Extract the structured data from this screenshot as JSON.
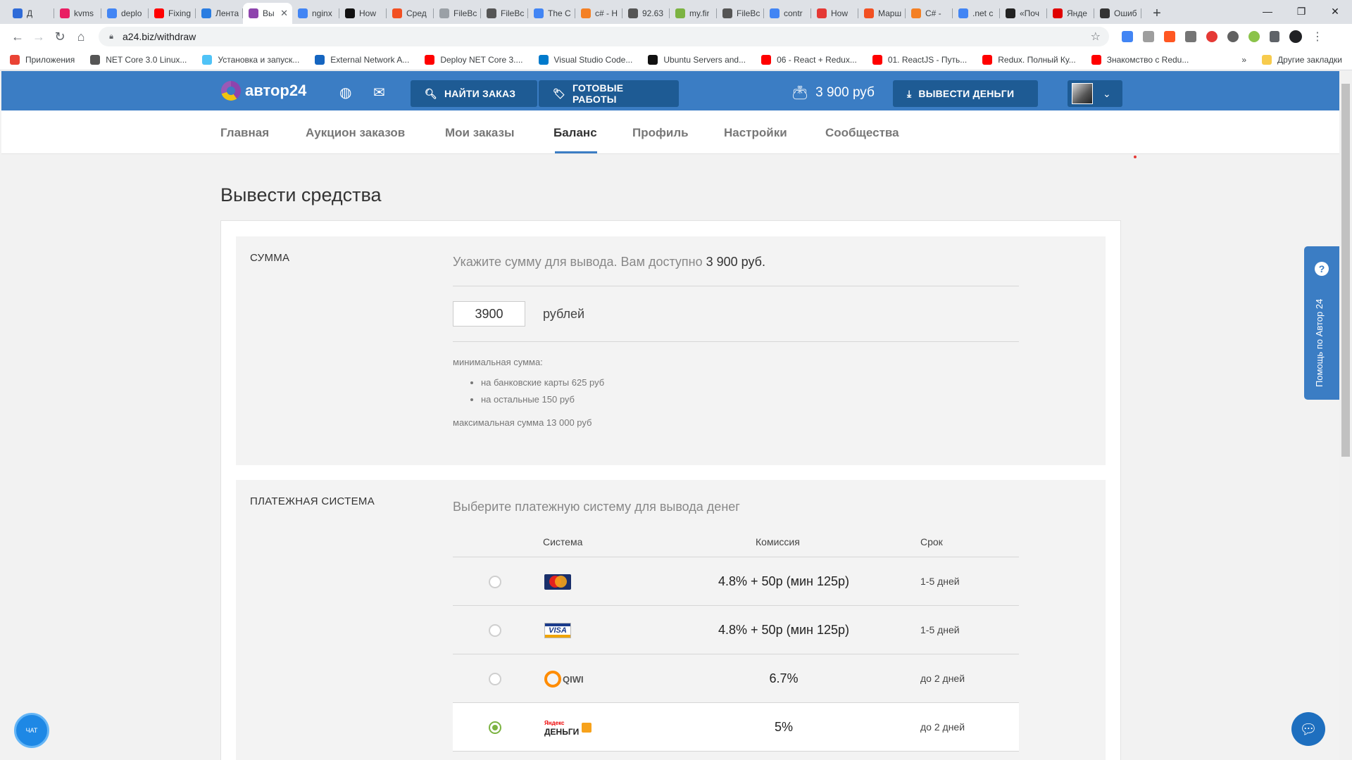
{
  "browser": {
    "tabs": [
      {
        "title": "Д",
        "color": "#2f6bd8"
      },
      {
        "title": "kvms",
        "color": "#e91e63"
      },
      {
        "title": "deplo",
        "color": "#4285f4"
      },
      {
        "title": "Fixing",
        "color": "#ff0000"
      },
      {
        "title": "Лента",
        "color": "#2a7de1"
      },
      {
        "title": "Вы",
        "color": "#8e44ad",
        "active": true
      },
      {
        "title": "nginx",
        "color": "#4285f4"
      },
      {
        "title": "How",
        "color": "#111111"
      },
      {
        "title": "Сред",
        "color": "#f25022"
      },
      {
        "title": "FileBc",
        "color": "#9aa0a6"
      },
      {
        "title": "FileBc",
        "color": "#555555"
      },
      {
        "title": "The C",
        "color": "#4285f4"
      },
      {
        "title": "c# - H",
        "color": "#f48024"
      },
      {
        "title": "92.63",
        "color": "#555555"
      },
      {
        "title": "my.fir",
        "color": "#7cb342"
      },
      {
        "title": "FileBc",
        "color": "#555555"
      },
      {
        "title": "contr",
        "color": "#4285f4"
      },
      {
        "title": "How",
        "color": "#e53935"
      },
      {
        "title": "Марш",
        "color": "#f25022"
      },
      {
        "title": "C# -",
        "color": "#f48024"
      },
      {
        "title": ".net c",
        "color": "#4285f4"
      },
      {
        "title": "«Поч",
        "color": "#222222"
      },
      {
        "title": "Янде",
        "color": "#e00000"
      },
      {
        "title": "Ошиб",
        "color": "#333333"
      }
    ],
    "url": "a24.biz/withdraw",
    "bookmarks": [
      {
        "label": "Приложения",
        "color": "#ea4335"
      },
      {
        "label": "NET Core 3.0 Linux...",
        "color": "#555555"
      },
      {
        "label": "Установка и запуск...",
        "color": "#4fc3f7"
      },
      {
        "label": "External Network A...",
        "color": "#1565c0"
      },
      {
        "label": "Deploy NET Core 3....",
        "color": "#ff0000"
      },
      {
        "label": "Visual Studio Code...",
        "color": "#007acc"
      },
      {
        "label": "Ubuntu Servers and...",
        "color": "#111111"
      },
      {
        "label": "06 - React + Redux...",
        "color": "#ff0000"
      },
      {
        "label": "01. ReactJS - Путь...",
        "color": "#ff0000"
      },
      {
        "label": "Redux. Полный Ку...",
        "color": "#ff0000"
      },
      {
        "label": "Знакомство с Redu...",
        "color": "#ff0000"
      }
    ],
    "bookmarks_overflow": "»",
    "other_bookmarks": "Другие закладки"
  },
  "header": {
    "logo_text": "автор24",
    "find_order": "НАЙТИ ЗАКАЗ",
    "ready_works": "ГОТОВЫЕ РАБОТЫ",
    "balance": "3 900 руб",
    "withdraw": "ВЫВЕСТИ ДЕНЬГИ"
  },
  "nav": {
    "items": [
      "Главная",
      "Аукцион заказов",
      "Мои заказы",
      "Баланс",
      "Профиль",
      "Настройки",
      "Сообщества"
    ],
    "active": "Баланс"
  },
  "page": {
    "title": "Вывести средства",
    "sum": {
      "label": "СУММА",
      "prompt": "Укажите сумму для вывода. Вам доступно",
      "available": "3 900 руб.",
      "value": "3900",
      "unit": "рублей",
      "min_label": "минимальная сумма:",
      "min_items": [
        "на банковские карты 625 руб",
        "на остальные 150 руб"
      ],
      "max_label": "максимальная сумма 13 000 руб"
    },
    "payment": {
      "label": "ПЛАТЕЖНАЯ СИСТЕМА",
      "prompt": "Выберите платежную систему для вывода денег",
      "columns": {
        "system": "Система",
        "fee": "Комиссия",
        "term": "Срок"
      },
      "rows": [
        {
          "system": "MasterCard",
          "fee": "4.8% + 50р (мин 125р)",
          "term": "1-5 дней",
          "selected": false
        },
        {
          "system": "VISA",
          "fee": "4.8% + 50р (мин 125р)",
          "term": "1-5 дней",
          "selected": false
        },
        {
          "system": "QIWI",
          "fee": "6.7%",
          "term": "до 2 дней",
          "selected": false
        },
        {
          "system": "Яндекс Деньги",
          "fee": "5%",
          "term": "до 2 дней",
          "selected": true
        }
      ],
      "logo_text": {
        "visa": "VISA",
        "qiwi": "QIWI",
        "yandex_top": "Яндекс",
        "yandex_bottom": "ДЕНЬГИ"
      }
    }
  },
  "help_tab": "Помощь по Автор 24",
  "chat_label": "ЧАТ"
}
